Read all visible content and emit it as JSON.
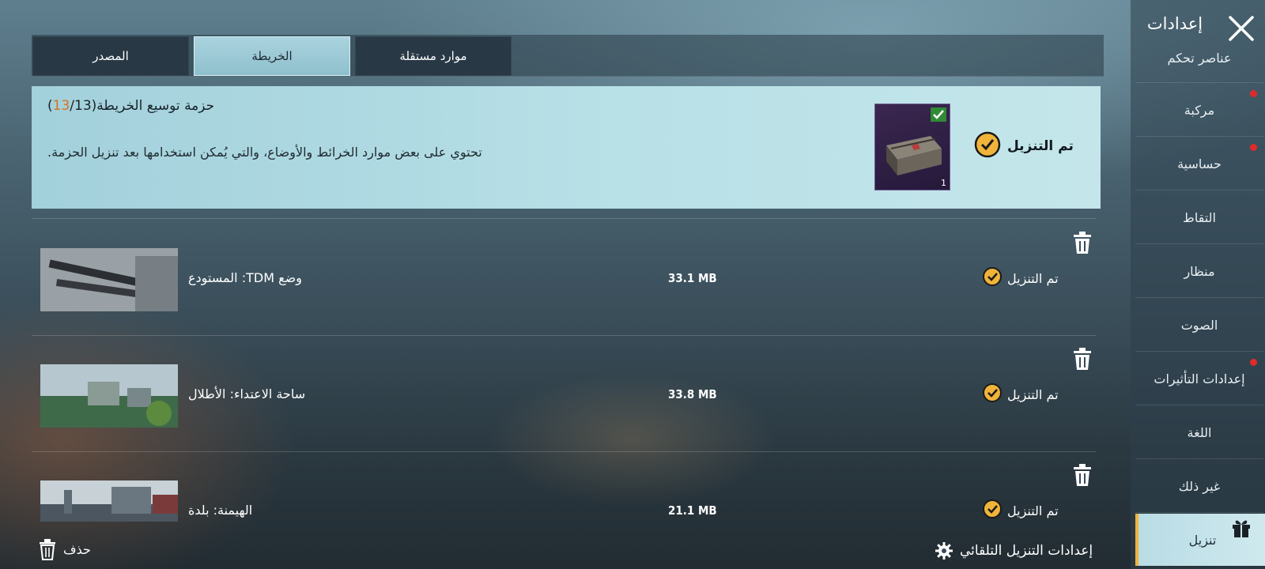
{
  "settings": {
    "title": "إعدادات"
  },
  "sidebar": {
    "items": [
      {
        "label": "عناصر تحكم",
        "dot": false
      },
      {
        "label": "مركبة",
        "dot": true
      },
      {
        "label": "حساسية",
        "dot": true
      },
      {
        "label": "التقاط",
        "dot": false
      },
      {
        "label": "منظار",
        "dot": false
      },
      {
        "label": "الصوت",
        "dot": false
      },
      {
        "label": "إعدادات التأثيرات",
        "dot": true
      },
      {
        "label": "اللغة",
        "dot": false
      },
      {
        "label": "غير ذلك",
        "dot": false
      },
      {
        "label": "تنزيل",
        "dot": false,
        "active": true,
        "icon": "gift-icon"
      }
    ]
  },
  "tabs": [
    {
      "label": "المصدر"
    },
    {
      "label": "الخريطة",
      "active": true
    },
    {
      "label": "موارد مستقلة"
    }
  ],
  "pack": {
    "title_prefix": "حزمة توسيع الخريطة(",
    "downloaded_count": "13",
    "title_suffix": "/13)",
    "description": "تحتوي على بعض موارد الخرائط والأوضاع، والتي يُمكن استخدامها بعد تنزيل الحزمة.",
    "status": "تم التنزيل",
    "item_count": "1"
  },
  "rows": [
    {
      "title": "وضع TDM: المستودع",
      "size": "33.1 MB",
      "status": "تم التنزيل",
      "thumb": "rifles"
    },
    {
      "title": "ساحة الاعتداء: الأطلال",
      "size": "33.8 MB",
      "status": "تم التنزيل",
      "thumb": "ruins"
    },
    {
      "title": "الهيمنة: بلدة",
      "size": "21.1 MB",
      "status": "تم التنزيل",
      "thumb": "town"
    }
  ],
  "footer": {
    "delete_label": "حذف",
    "auto_download_label": "إعدادات التنزيل التلقائي"
  },
  "colors": {
    "accent_gold": "#f0b43a",
    "tab_active": "#9fcbd6",
    "badge_red": "#e02a2a",
    "pack_count_orange": "#d9731e"
  }
}
